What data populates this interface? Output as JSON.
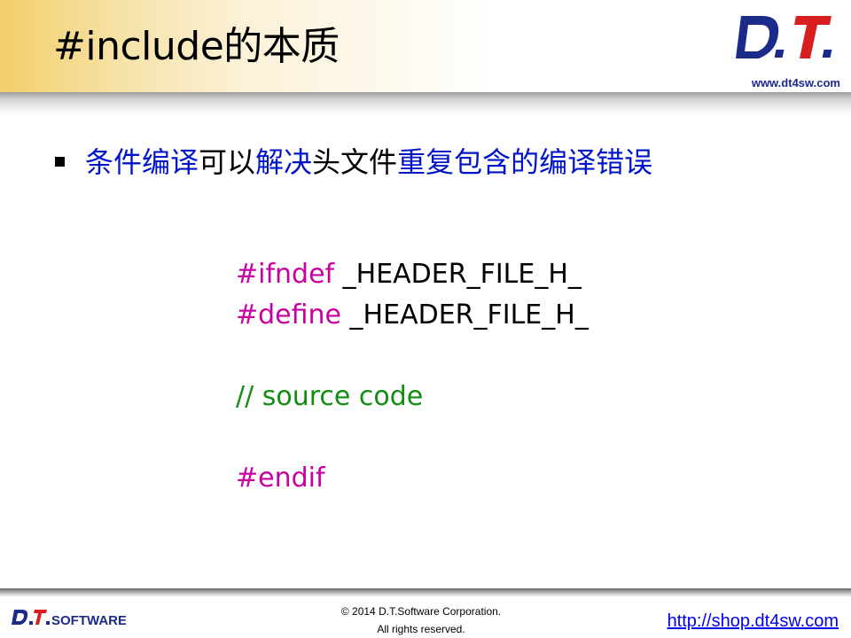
{
  "slide": {
    "title": "#include的本质",
    "logo": {
      "text": "D.T.",
      "url": "www.dt4sw.com"
    },
    "bullet": {
      "segments": [
        {
          "text": "条件编译",
          "color": "#0014c8"
        },
        {
          "text": "可以",
          "color": "#000000"
        },
        {
          "text": "解决",
          "color": "#0014c8"
        },
        {
          "text": "头文件",
          "color": "#000000"
        },
        {
          "text": "重复包含的编译错误",
          "color": "#0014c8"
        }
      ]
    },
    "code": {
      "line1_kw": "#ifndef",
      "line1_rest": " _HEADER_FILE_H_",
      "line2_kw": "#define",
      "line2_rest": " _HEADER_FILE_H_",
      "line3_comment": "// source code",
      "line4_kw": "#endif"
    }
  },
  "footer": {
    "logo_text": "D.T.SOFTWARE",
    "copyright_line1": "© 2014 D.T.Software Corporation.",
    "copyright_line2": "All rights reserved.",
    "link": "http://shop.dt4sw.com"
  },
  "colors": {
    "accent_blue": "#0014c8",
    "keyword_magenta": "#c800a0",
    "comment_green": "#128c12",
    "header_gold": "#f2cf6b",
    "logo_navy": "#1c2a8a",
    "logo_red": "#d81e1e"
  }
}
